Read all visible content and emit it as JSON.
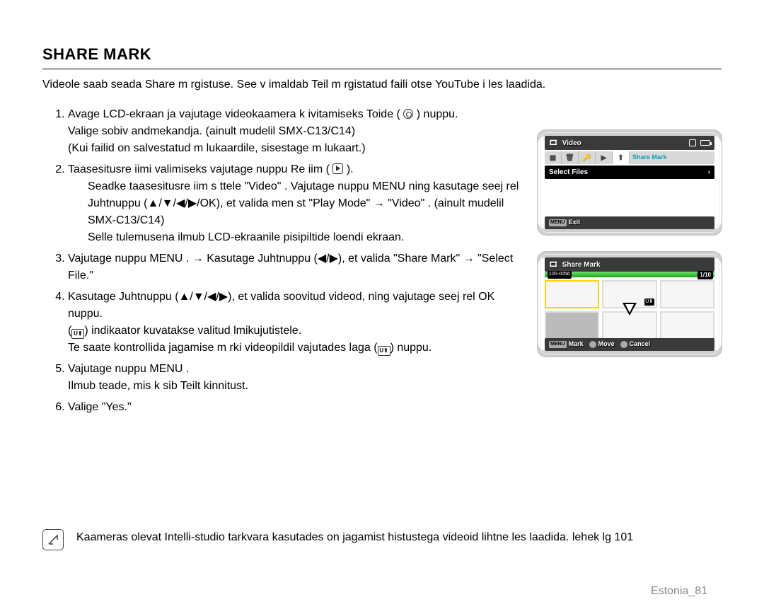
{
  "heading": "SHARE MARK",
  "intro": "Videole saab seada Share m rgistuse. See v imaldab Teil m rgistatud faili otse YouTube i  les laadida.",
  "steps": {
    "s1": {
      "main": "Avage LCD-ekraan ja vajutage videokaamera k ivitamiseks Toide  (",
      "after_icon": ") nuppu.",
      "sub1": "Valige sobiv andmekandja. (ainult mudelil SMX-C13/C14)",
      "sub2": "(Kui failid on salvestatud m lukaardile, sisestage m lukaart.)"
    },
    "s2": {
      "main_a": "Taasesitusre iimi valimiseks vajutage nuppu Re iim  (",
      "main_b": ").",
      "sub1": "Seadke taasesitusre iim s ttele \"Video\" . Vajutage nuppu MENU  ning kasutage seej rel Juhtnuppu  (▲/▼/◀/▶/OK), et valida men  st \"Play Mode\"  → \"Video\" . (ainult mudelil SMX-C13/C14)",
      "sub2": "Selle tulemusena ilmub LCD-ekraanile pisipiltide loendi ekraan."
    },
    "s3": {
      "main": "Vajutage nuppu MENU . → Kasutage Juhtnuppu  (◀/▶), et valida \"Share Mark\"  → \"Select File.\""
    },
    "s4": {
      "main": "Kasutage Juhtnuppu  (▲/▼/◀/▶), et valida soovitud videod, ning vajutage seej rel OK nuppu.",
      "sub1_a": "(",
      "sub1_b": ") indikaator kuvatakse valitud  lmikujutistele.",
      "sub2_a": "Te saate kontrollida jagamise m rki videopildil vajutades laga (",
      "sub2_b": ") nuppu."
    },
    "s5": {
      "main": "Vajutage nuppu MENU .",
      "sub": "Ilmub teade, mis k sib Teilt kinnitust."
    },
    "s6": {
      "main": "Valige \"Yes.\""
    }
  },
  "screen1": {
    "title": "Video",
    "share_tab": "Share Mark",
    "select_files": "Select Files",
    "exit": "Exit",
    "menu": "MENU"
  },
  "screen2": {
    "title": "Share Mark",
    "count": "1/10",
    "menu": "MENU",
    "mark": "Mark",
    "move": "Move",
    "cancel": "Cancel"
  },
  "note": "Kaameras olevat Intelli-studio tarkvara kasutades on jagamist histustega videoid lihtne  les laadida. lehek lg 101",
  "footer": "Estonia_81"
}
